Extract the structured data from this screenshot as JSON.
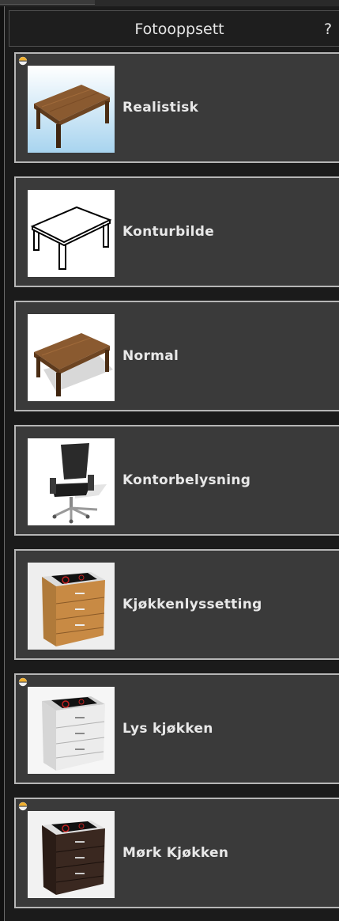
{
  "panel": {
    "title": "Fotooppsett",
    "help_label": "?"
  },
  "presets": [
    {
      "label": "Realistisk",
      "thumbnail": "table-wood-realistic",
      "badge": true
    },
    {
      "label": "Konturbilde",
      "thumbnail": "table-outline",
      "badge": false
    },
    {
      "label": "Normal",
      "thumbnail": "table-wood-normal",
      "badge": false
    },
    {
      "label": "Kontorbelysning",
      "thumbnail": "office-chair",
      "badge": false
    },
    {
      "label": "Kjøkkenlyssetting",
      "thumbnail": "kitchen-cabinet-wood",
      "badge": false
    },
    {
      "label": "Lys kjøkken",
      "thumbnail": "kitchen-cabinet-white",
      "badge": true
    },
    {
      "label": "Mørk Kjøkken",
      "thumbnail": "kitchen-cabinet-dark",
      "badge": true
    }
  ],
  "colors": {
    "panel_bg": "#1b1b1b",
    "item_bg": "#3a3a3a",
    "item_border": "#b6b6b6",
    "text": "#e8e8e8"
  }
}
